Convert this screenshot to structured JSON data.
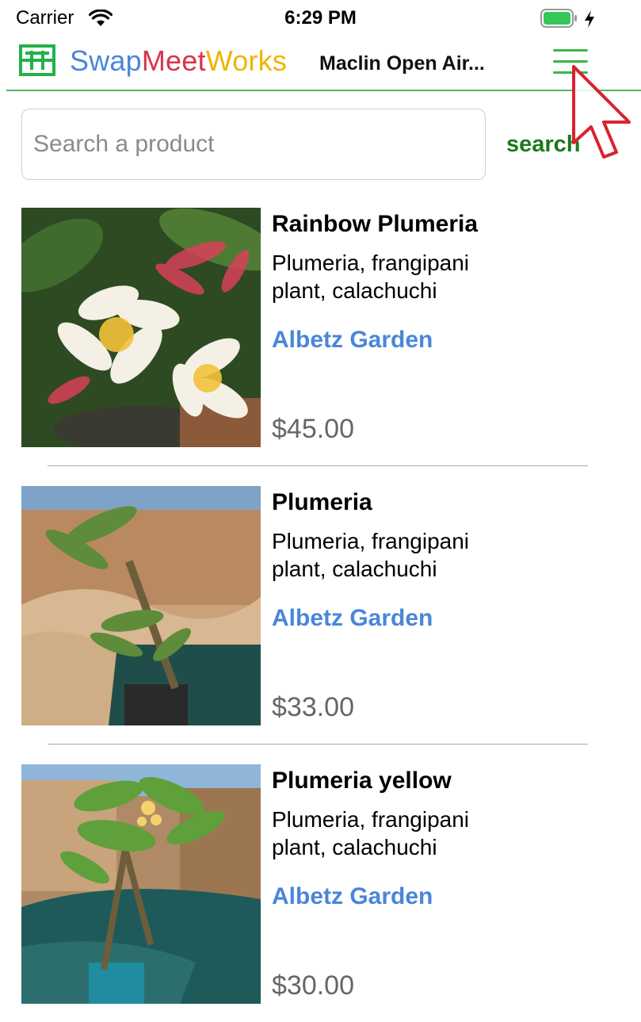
{
  "status_bar": {
    "carrier": "Carrier",
    "time": "6:29 PM",
    "battery_level": 1.0
  },
  "header": {
    "brand_part1": "Swap",
    "brand_part2": "Meet",
    "brand_part3": "Works",
    "market_name": "Maclin Open Air...",
    "logo_icon": "swapmeetworks-logo-icon",
    "menu_icon": "hamburger-menu-icon"
  },
  "search": {
    "placeholder": "Search a product",
    "value": "",
    "button_label": "search"
  },
  "products": [
    {
      "name": "Rainbow Plumeria",
      "description": "Plumeria, frangipani plant, calachuchi",
      "seller": "Albetz Garden",
      "price": "$45.00"
    },
    {
      "name": "Plumeria",
      "description": "Plumeria, frangipani plant, calachuchi",
      "seller": "Albetz Garden",
      "price": "$33.00"
    },
    {
      "name": "Plumeria yellow",
      "description": "Plumeria, frangipani plant, calachuchi",
      "seller": "Albetz Garden",
      "price": "$30.00"
    }
  ],
  "colors": {
    "brand_blue": "#4a86d9",
    "brand_red": "#d8334a",
    "brand_yellow": "#f0b400",
    "accent_green": "#3cb54a",
    "search_green": "#1a7a1a",
    "seller_blue": "#4a86d9",
    "price_gray": "#666666"
  }
}
